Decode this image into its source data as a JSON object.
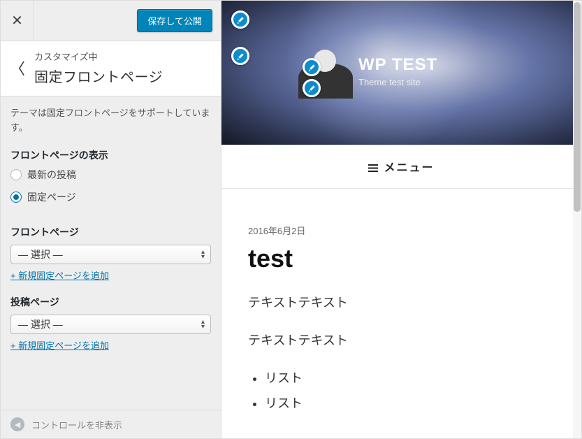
{
  "header": {
    "publish_label": "保存して公開"
  },
  "section": {
    "breadcrumb": "カスタマイズ中",
    "title": "固定フロントページ"
  },
  "description": "テーマは固定フロントページをサポートしています。",
  "controls": {
    "display_label": "フロントページの表示",
    "radio_latest": "最新の投稿",
    "radio_static": "固定ページ",
    "front_page_label": "フロントページ",
    "posts_page_label": "投稿ページ",
    "select_placeholder": "— 選択 —",
    "add_new_label": "+ 新規固定ページを追加"
  },
  "footer": {
    "hide_controls": "コントロールを非表示"
  },
  "preview": {
    "site_title": "WP TEST",
    "tagline": "Theme test site",
    "menu_label": "メニュー",
    "post_date": "2016年6月2日",
    "post_title": "test",
    "para1": "テキストテキスト",
    "para2": "テキストテキスト",
    "list1": "リスト",
    "list2": "リスト"
  }
}
